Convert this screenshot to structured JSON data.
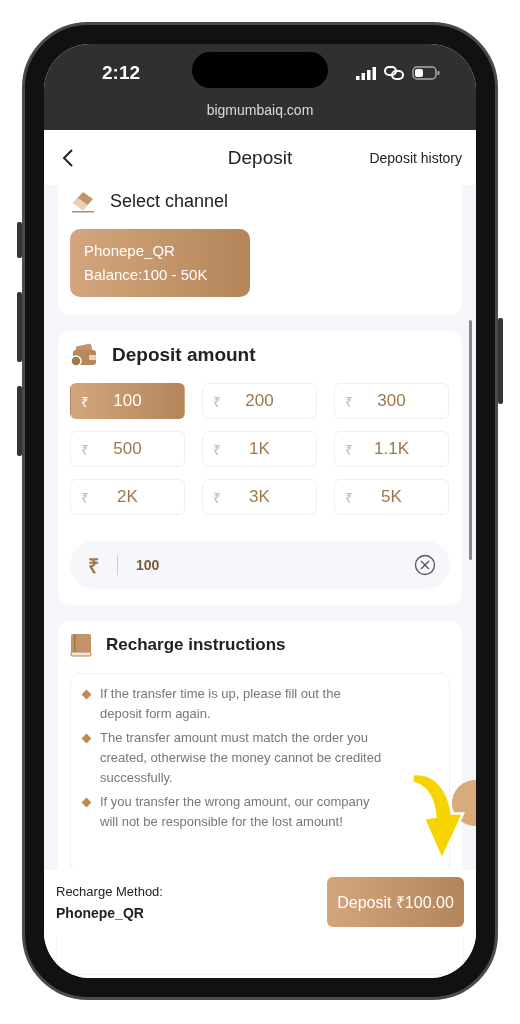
{
  "status_bar": {
    "time": "2:12",
    "url": "bigmumbaiq.com"
  },
  "header": {
    "title": "Deposit",
    "link": "Deposit history"
  },
  "channel_section": {
    "title": "Select channel",
    "channels": [
      {
        "name": "Phonepe_QR",
        "balance": "Balance:100 - 50K",
        "selected": true
      }
    ]
  },
  "amount_section": {
    "title": "Deposit amount",
    "options": [
      {
        "symbol": "₹",
        "amount": "100",
        "selected": true
      },
      {
        "symbol": "₹",
        "amount": "200",
        "selected": false
      },
      {
        "symbol": "₹",
        "amount": "300",
        "selected": false
      },
      {
        "symbol": "₹",
        "amount": "500",
        "selected": false
      },
      {
        "symbol": "₹",
        "amount": "1K",
        "selected": false
      },
      {
        "symbol": "₹",
        "amount": "1.1K",
        "selected": false
      },
      {
        "symbol": "₹",
        "amount": "2K",
        "selected": false
      },
      {
        "symbol": "₹",
        "amount": "3K",
        "selected": false
      },
      {
        "symbol": "₹",
        "amount": "5K",
        "selected": false
      }
    ],
    "input": {
      "symbol": "₹",
      "value": "100"
    }
  },
  "instructions": {
    "title": "Recharge instructions",
    "items": [
      "If the transfer time is up, please fill out the deposit form again.",
      "The transfer amount must match the order you created, otherwise the money cannot be credited successfully.",
      "If you transfer the wrong amount, our company will not be responsible for the lost amount!"
    ]
  },
  "footer": {
    "label": "Recharge Method:",
    "method": "Phonepe_QR",
    "button": "Deposit ₹100.00"
  }
}
